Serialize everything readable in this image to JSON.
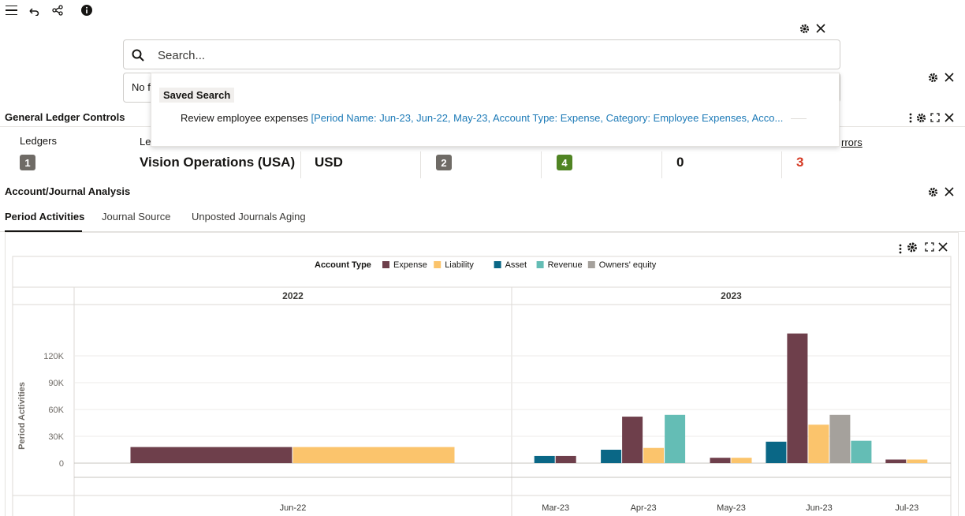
{
  "toolbar": {
    "icons": [
      "menu-icon",
      "undo-icon",
      "share-icon",
      "info-icon"
    ]
  },
  "search": {
    "placeholder": "Search...",
    "filter_text": "No f"
  },
  "saved_search": {
    "header": "Saved Search",
    "item_name": "Review employee expenses",
    "item_criteria": "[Period Name: Jun-23, Jun-22, May-23, Account Type: Expense, Category: Employee Expenses, Acco..."
  },
  "gl_controls": {
    "title": "General Ledger Controls",
    "ledgers_label": "Ledgers",
    "ledger_col_label": "Le",
    "errors_label": "rrors",
    "ledgers_count": "1",
    "ledger_name": "Vision Operations (USA)",
    "currency": "USD",
    "count_a": "2",
    "count_b": "4",
    "count_c": "0",
    "errors_count": "3"
  },
  "analysis": {
    "title": "Account/Journal Analysis",
    "tabs": [
      "Period Activities",
      "Journal Source",
      "Unposted Journals Aging"
    ],
    "active_tab": 0
  },
  "colors": {
    "expense": "#6e3f4b",
    "liability": "#fbc46c",
    "asset": "#0a6786",
    "revenue": "#64bdb5",
    "owners_equity": "#a5a19c",
    "badge_gray": "#6f6b66",
    "badge_green": "#508423",
    "error_red": "#d63b25",
    "link_blue": "#1c7ab7"
  },
  "chart_data": {
    "type": "bar",
    "legend_title": "Account Type",
    "legend_position": "top",
    "ylabel": "Period Activities",
    "ylim": [
      -10000,
      140000
    ],
    "yticks": [
      0,
      30000,
      60000,
      90000,
      120000
    ],
    "ytick_labels": [
      "0",
      "30K",
      "60K",
      "90K",
      "120K"
    ],
    "series": [
      {
        "name": "Expense",
        "color": "#6e3f4b"
      },
      {
        "name": "Liability",
        "color": "#fbc46c"
      },
      {
        "name": "Asset",
        "color": "#0a6786"
      },
      {
        "name": "Revenue",
        "color": "#64bdb5"
      },
      {
        "name": "Owners' equity",
        "color": "#a5a19c"
      }
    ],
    "groups": [
      {
        "year": "2022",
        "periods": [
          {
            "label": "Jun-22",
            "values": {
              "Expense": 18000,
              "Liability": 18000
            }
          }
        ]
      },
      {
        "year": "2023",
        "periods": [
          {
            "label": "Mar-23",
            "values": {
              "Asset": 8000,
              "Expense": 8000
            }
          },
          {
            "label": "Apr-23",
            "values": {
              "Asset": 15000,
              "Expense": 52000,
              "Liability": 17000,
              "Revenue": 54000
            }
          },
          {
            "label": "May-23",
            "values": {
              "Expense": 6000,
              "Liability": 6000
            }
          },
          {
            "label": "Jun-23",
            "values": {
              "Asset": 24000,
              "Expense": 145000,
              "Liability": 43000,
              "Owners' equity": 54000,
              "Revenue": 25000
            }
          },
          {
            "label": "Jul-23",
            "values": {
              "Expense": 4000,
              "Liability": 4000
            }
          }
        ]
      }
    ]
  }
}
